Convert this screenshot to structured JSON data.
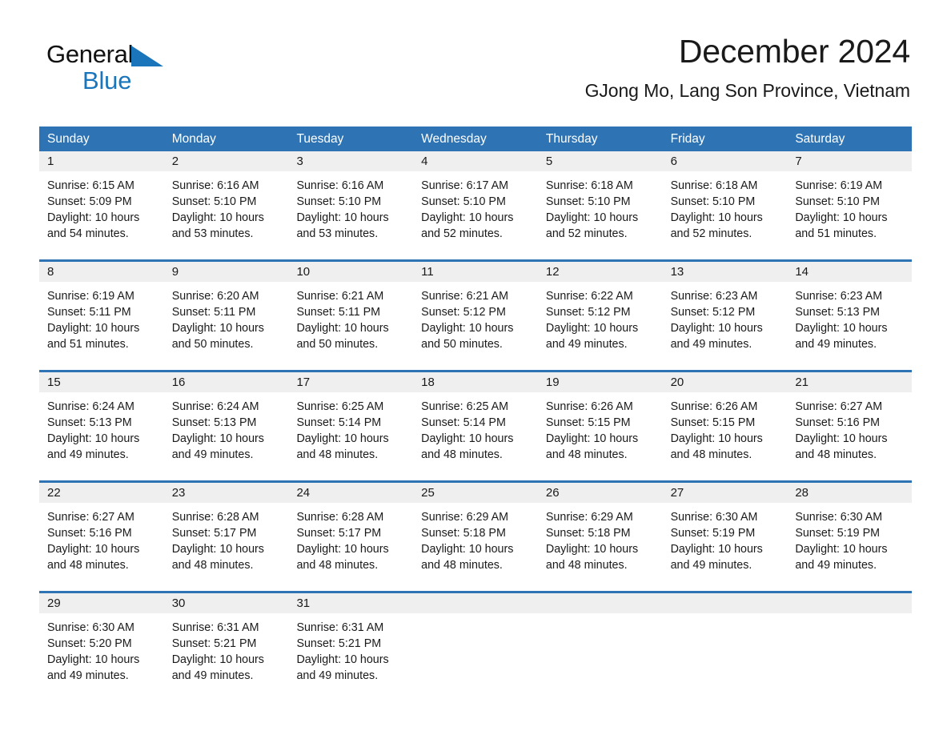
{
  "brand": {
    "name_part1": "General",
    "name_part2": "Blue",
    "accent_color": "#1a75bb",
    "logo_triangle_icon": "triangle-icon"
  },
  "header": {
    "title": "December 2024",
    "subtitle": "GJong Mo, Lang Son Province, Vietnam"
  },
  "calendar": {
    "header_background": "#2e74b5",
    "day_number_background": "#efefef",
    "weekdays": [
      "Sunday",
      "Monday",
      "Tuesday",
      "Wednesday",
      "Thursday",
      "Friday",
      "Saturday"
    ],
    "weeks": [
      [
        {
          "day": "1",
          "sunrise": "Sunrise: 6:15 AM",
          "sunset": "Sunset: 5:09 PM",
          "daylight": "Daylight: 10 hours and 54 minutes."
        },
        {
          "day": "2",
          "sunrise": "Sunrise: 6:16 AM",
          "sunset": "Sunset: 5:10 PM",
          "daylight": "Daylight: 10 hours and 53 minutes."
        },
        {
          "day": "3",
          "sunrise": "Sunrise: 6:16 AM",
          "sunset": "Sunset: 5:10 PM",
          "daylight": "Daylight: 10 hours and 53 minutes."
        },
        {
          "day": "4",
          "sunrise": "Sunrise: 6:17 AM",
          "sunset": "Sunset: 5:10 PM",
          "daylight": "Daylight: 10 hours and 52 minutes."
        },
        {
          "day": "5",
          "sunrise": "Sunrise: 6:18 AM",
          "sunset": "Sunset: 5:10 PM",
          "daylight": "Daylight: 10 hours and 52 minutes."
        },
        {
          "day": "6",
          "sunrise": "Sunrise: 6:18 AM",
          "sunset": "Sunset: 5:10 PM",
          "daylight": "Daylight: 10 hours and 52 minutes."
        },
        {
          "day": "7",
          "sunrise": "Sunrise: 6:19 AM",
          "sunset": "Sunset: 5:10 PM",
          "daylight": "Daylight: 10 hours and 51 minutes."
        }
      ],
      [
        {
          "day": "8",
          "sunrise": "Sunrise: 6:19 AM",
          "sunset": "Sunset: 5:11 PM",
          "daylight": "Daylight: 10 hours and 51 minutes."
        },
        {
          "day": "9",
          "sunrise": "Sunrise: 6:20 AM",
          "sunset": "Sunset: 5:11 PM",
          "daylight": "Daylight: 10 hours and 50 minutes."
        },
        {
          "day": "10",
          "sunrise": "Sunrise: 6:21 AM",
          "sunset": "Sunset: 5:11 PM",
          "daylight": "Daylight: 10 hours and 50 minutes."
        },
        {
          "day": "11",
          "sunrise": "Sunrise: 6:21 AM",
          "sunset": "Sunset: 5:12 PM",
          "daylight": "Daylight: 10 hours and 50 minutes."
        },
        {
          "day": "12",
          "sunrise": "Sunrise: 6:22 AM",
          "sunset": "Sunset: 5:12 PM",
          "daylight": "Daylight: 10 hours and 49 minutes."
        },
        {
          "day": "13",
          "sunrise": "Sunrise: 6:23 AM",
          "sunset": "Sunset: 5:12 PM",
          "daylight": "Daylight: 10 hours and 49 minutes."
        },
        {
          "day": "14",
          "sunrise": "Sunrise: 6:23 AM",
          "sunset": "Sunset: 5:13 PM",
          "daylight": "Daylight: 10 hours and 49 minutes."
        }
      ],
      [
        {
          "day": "15",
          "sunrise": "Sunrise: 6:24 AM",
          "sunset": "Sunset: 5:13 PM",
          "daylight": "Daylight: 10 hours and 49 minutes."
        },
        {
          "day": "16",
          "sunrise": "Sunrise: 6:24 AM",
          "sunset": "Sunset: 5:13 PM",
          "daylight": "Daylight: 10 hours and 49 minutes."
        },
        {
          "day": "17",
          "sunrise": "Sunrise: 6:25 AM",
          "sunset": "Sunset: 5:14 PM",
          "daylight": "Daylight: 10 hours and 48 minutes."
        },
        {
          "day": "18",
          "sunrise": "Sunrise: 6:25 AM",
          "sunset": "Sunset: 5:14 PM",
          "daylight": "Daylight: 10 hours and 48 minutes."
        },
        {
          "day": "19",
          "sunrise": "Sunrise: 6:26 AM",
          "sunset": "Sunset: 5:15 PM",
          "daylight": "Daylight: 10 hours and 48 minutes."
        },
        {
          "day": "20",
          "sunrise": "Sunrise: 6:26 AM",
          "sunset": "Sunset: 5:15 PM",
          "daylight": "Daylight: 10 hours and 48 minutes."
        },
        {
          "day": "21",
          "sunrise": "Sunrise: 6:27 AM",
          "sunset": "Sunset: 5:16 PM",
          "daylight": "Daylight: 10 hours and 48 minutes."
        }
      ],
      [
        {
          "day": "22",
          "sunrise": "Sunrise: 6:27 AM",
          "sunset": "Sunset: 5:16 PM",
          "daylight": "Daylight: 10 hours and 48 minutes."
        },
        {
          "day": "23",
          "sunrise": "Sunrise: 6:28 AM",
          "sunset": "Sunset: 5:17 PM",
          "daylight": "Daylight: 10 hours and 48 minutes."
        },
        {
          "day": "24",
          "sunrise": "Sunrise: 6:28 AM",
          "sunset": "Sunset: 5:17 PM",
          "daylight": "Daylight: 10 hours and 48 minutes."
        },
        {
          "day": "25",
          "sunrise": "Sunrise: 6:29 AM",
          "sunset": "Sunset: 5:18 PM",
          "daylight": "Daylight: 10 hours and 48 minutes."
        },
        {
          "day": "26",
          "sunrise": "Sunrise: 6:29 AM",
          "sunset": "Sunset: 5:18 PM",
          "daylight": "Daylight: 10 hours and 48 minutes."
        },
        {
          "day": "27",
          "sunrise": "Sunrise: 6:30 AM",
          "sunset": "Sunset: 5:19 PM",
          "daylight": "Daylight: 10 hours and 49 minutes."
        },
        {
          "day": "28",
          "sunrise": "Sunrise: 6:30 AM",
          "sunset": "Sunset: 5:19 PM",
          "daylight": "Daylight: 10 hours and 49 minutes."
        }
      ],
      [
        {
          "day": "29",
          "sunrise": "Sunrise: 6:30 AM",
          "sunset": "Sunset: 5:20 PM",
          "daylight": "Daylight: 10 hours and 49 minutes."
        },
        {
          "day": "30",
          "sunrise": "Sunrise: 6:31 AM",
          "sunset": "Sunset: 5:21 PM",
          "daylight": "Daylight: 10 hours and 49 minutes."
        },
        {
          "day": "31",
          "sunrise": "Sunrise: 6:31 AM",
          "sunset": "Sunset: 5:21 PM",
          "daylight": "Daylight: 10 hours and 49 minutes."
        },
        {
          "day": "",
          "sunrise": "",
          "sunset": "",
          "daylight": ""
        },
        {
          "day": "",
          "sunrise": "",
          "sunset": "",
          "daylight": ""
        },
        {
          "day": "",
          "sunrise": "",
          "sunset": "",
          "daylight": ""
        },
        {
          "day": "",
          "sunrise": "",
          "sunset": "",
          "daylight": ""
        }
      ]
    ]
  }
}
